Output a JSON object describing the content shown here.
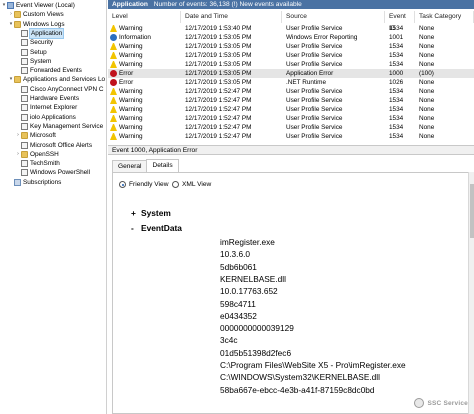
{
  "tree": {
    "items": [
      {
        "label": "Event Viewer (Local)",
        "icon": "event-viewer-icon",
        "expander": "▾",
        "indent": 0
      },
      {
        "label": "Custom Views",
        "icon": "folder-icon",
        "expander": "›",
        "indent": 1
      },
      {
        "label": "Windows Logs",
        "icon": "folder-icon",
        "expander": "▾",
        "indent": 1
      },
      {
        "label": "Application",
        "icon": "log-icon",
        "expander": "",
        "indent": 2,
        "selected": true
      },
      {
        "label": "Security",
        "icon": "log-icon",
        "expander": "",
        "indent": 2
      },
      {
        "label": "Setup",
        "icon": "log-icon",
        "expander": "",
        "indent": 2
      },
      {
        "label": "System",
        "icon": "log-icon",
        "expander": "",
        "indent": 2
      },
      {
        "label": "Forwarded Events",
        "icon": "log-icon",
        "expander": "",
        "indent": 2
      },
      {
        "label": "Applications and Services Lo",
        "icon": "folder-icon",
        "expander": "▾",
        "indent": 1
      },
      {
        "label": "Cisco AnyConnect VPN C",
        "icon": "log-icon",
        "expander": "",
        "indent": 2
      },
      {
        "label": "Hardware Events",
        "icon": "log-icon",
        "expander": "",
        "indent": 2
      },
      {
        "label": "Internet Explorer",
        "icon": "log-icon",
        "expander": "",
        "indent": 2
      },
      {
        "label": "iolo Applications",
        "icon": "log-icon",
        "expander": "",
        "indent": 2
      },
      {
        "label": "Key Management Service",
        "icon": "log-icon",
        "expander": "",
        "indent": 2
      },
      {
        "label": "Microsoft",
        "icon": "folder-icon",
        "expander": "›",
        "indent": 2
      },
      {
        "label": "Microsoft Office Alerts",
        "icon": "log-icon",
        "expander": "",
        "indent": 2
      },
      {
        "label": "OpenSSH",
        "icon": "folder-icon",
        "expander": "›",
        "indent": 2
      },
      {
        "label": "TechSmith",
        "icon": "log-icon",
        "expander": "",
        "indent": 2
      },
      {
        "label": "Windows PowerShell",
        "icon": "log-icon",
        "expander": "",
        "indent": 2
      },
      {
        "label": "Subscriptions",
        "icon": "subscriptions-icon",
        "expander": "",
        "indent": 1
      }
    ]
  },
  "header": {
    "title": "Application",
    "count_text": "Number of events: 36,138 (!) New events available"
  },
  "table": {
    "columns": [
      "Level",
      "Date and Time",
      "Source",
      "Event ID",
      "Task Category"
    ],
    "rows": [
      {
        "level": "Warning",
        "icon": "warning-icon",
        "date": "12/17/2019 1:53:40 PM",
        "source": "User Profile Service",
        "id": "1534",
        "task": "None"
      },
      {
        "level": "Information",
        "icon": "information-icon",
        "date": "12/17/2019 1:53:05 PM",
        "source": "Windows Error Reporting",
        "id": "1001",
        "task": "None"
      },
      {
        "level": "Warning",
        "icon": "warning-icon",
        "date": "12/17/2019 1:53:05 PM",
        "source": "User Profile Service",
        "id": "1534",
        "task": "None"
      },
      {
        "level": "Warning",
        "icon": "warning-icon",
        "date": "12/17/2019 1:53:05 PM",
        "source": "User Profile Service",
        "id": "1534",
        "task": "None"
      },
      {
        "level": "Warning",
        "icon": "warning-icon",
        "date": "12/17/2019 1:53:05 PM",
        "source": "User Profile Service",
        "id": "1534",
        "task": "None"
      },
      {
        "level": "Error",
        "icon": "error-icon",
        "date": "12/17/2019 1:53:05 PM",
        "source": "Application Error",
        "id": "1000",
        "task": "(100)",
        "selected": true
      },
      {
        "level": "Error",
        "icon": "error-icon",
        "date": "12/17/2019 1:53:05 PM",
        "source": ".NET Runtime",
        "id": "1026",
        "task": "None"
      },
      {
        "level": "Warning",
        "icon": "warning-icon",
        "date": "12/17/2019 1:52:47 PM",
        "source": "User Profile Service",
        "id": "1534",
        "task": "None"
      },
      {
        "level": "Warning",
        "icon": "warning-icon",
        "date": "12/17/2019 1:52:47 PM",
        "source": "User Profile Service",
        "id": "1534",
        "task": "None"
      },
      {
        "level": "Warning",
        "icon": "warning-icon",
        "date": "12/17/2019 1:52:47 PM",
        "source": "User Profile Service",
        "id": "1534",
        "task": "None"
      },
      {
        "level": "Warning",
        "icon": "warning-icon",
        "date": "12/17/2019 1:52:47 PM",
        "source": "User Profile Service",
        "id": "1534",
        "task": "None"
      },
      {
        "level": "Warning",
        "icon": "warning-icon",
        "date": "12/17/2019 1:52:47 PM",
        "source": "User Profile Service",
        "id": "1534",
        "task": "None"
      },
      {
        "level": "Warning",
        "icon": "warning-icon",
        "date": "12/17/2019 1:52:47 PM",
        "source": "User Profile Service",
        "id": "1534",
        "task": "None"
      }
    ]
  },
  "detail": {
    "title": "Event 1000, Application Error",
    "tabs": [
      "General",
      "Details"
    ],
    "active_tab": "Details",
    "view_friendly": "Friendly View",
    "view_xml": "XML View",
    "system_label": "System",
    "system_toggle": "+",
    "eventdata_label": "EventData",
    "eventdata_toggle": "-",
    "values": [
      "imRegister.exe",
      "10.3.6.0",
      "5db6b061",
      "KERNELBASE.dll",
      "10.0.17763.652",
      "598c4711",
      "e0434352",
      "0000000000039129",
      "3c4c",
      "01d5b51398d2fec6",
      "C:\\Program Files\\WebSite X5 - Pro\\imRegister.exe",
      "C:\\WINDOWS\\System32\\KERNELBASE.dll",
      "58ba667e-ebcc-4e3b-a41f-87159c8dc0bd"
    ]
  },
  "watermark": "SSC Service"
}
